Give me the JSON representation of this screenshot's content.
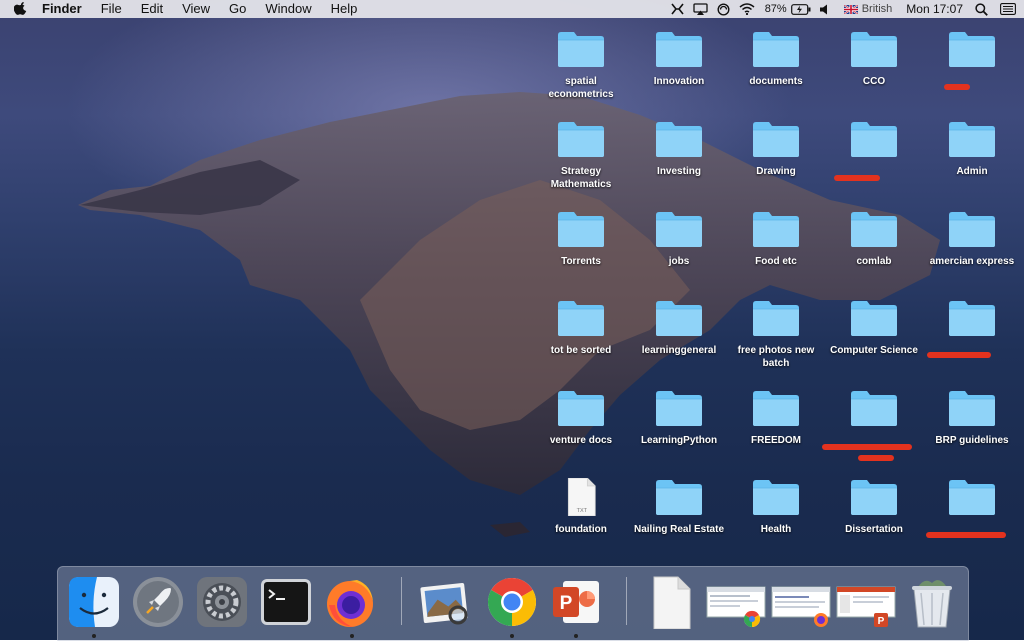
{
  "menubar": {
    "app_name": "Finder",
    "menus": [
      "File",
      "Edit",
      "View",
      "Go",
      "Window",
      "Help"
    ],
    "battery": "87%",
    "input_source": "British",
    "clock": "Mon 17:07"
  },
  "desktop": {
    "folders": [
      {
        "label": "spatial econometrics"
      },
      {
        "label": "Innovation"
      },
      {
        "label": "documents"
      },
      {
        "label": "CCO"
      },
      {
        "label": "",
        "redacted": true
      },
      {
        "label": "Strategy Mathematics"
      },
      {
        "label": "Investing"
      },
      {
        "label": "Drawing"
      },
      {
        "label": "",
        "redacted": true
      },
      {
        "label": "Admin"
      },
      {
        "label": "Torrents"
      },
      {
        "label": "jobs"
      },
      {
        "label": "Food etc"
      },
      {
        "label": "comlab"
      },
      {
        "label": "amercian express"
      },
      {
        "label": "tot be sorted"
      },
      {
        "label": "learninggeneral"
      },
      {
        "label": "free photos new batch"
      },
      {
        "label": "Computer Science"
      },
      {
        "label": "",
        "redacted": true
      },
      {
        "label": "venture docs"
      },
      {
        "label": "LearningPython"
      },
      {
        "label": "FREEDOM"
      },
      {
        "label": "",
        "redacted": true
      },
      {
        "label": "BRP guidelines"
      },
      {
        "label": "foundation",
        "kind": "txt-file",
        "badge": "TXT"
      },
      {
        "label": "Nailing Real Estate"
      },
      {
        "label": "Health"
      },
      {
        "label": "Dissertation"
      },
      {
        "label": "",
        "redacted": true
      }
    ]
  },
  "dock": {
    "apps": [
      {
        "icon": "finder-icon",
        "running": true
      },
      {
        "icon": "launchpad-icon",
        "running": false
      },
      {
        "icon": "system-preferences-icon",
        "running": false
      },
      {
        "icon": "terminal-icon",
        "running": false
      },
      {
        "icon": "firefox-icon",
        "running": true
      },
      {
        "icon": "preview-icon",
        "running": false
      },
      {
        "icon": "chrome-icon",
        "running": true
      },
      {
        "icon": "powerpoint-icon",
        "running": true
      },
      {
        "icon": "document-icon",
        "running": false
      },
      {
        "icon": "chrome-window-thumbnail",
        "running": false
      },
      {
        "icon": "firefox-window-thumbnail",
        "running": false
      },
      {
        "icon": "powerpoint-window-thumbnail",
        "running": false
      },
      {
        "icon": "trash-icon",
        "running": false
      }
    ]
  },
  "colors": {
    "folder": "#6cc4f5",
    "folder_tab": "#8fd3f8",
    "redaction": "#e3321e"
  }
}
